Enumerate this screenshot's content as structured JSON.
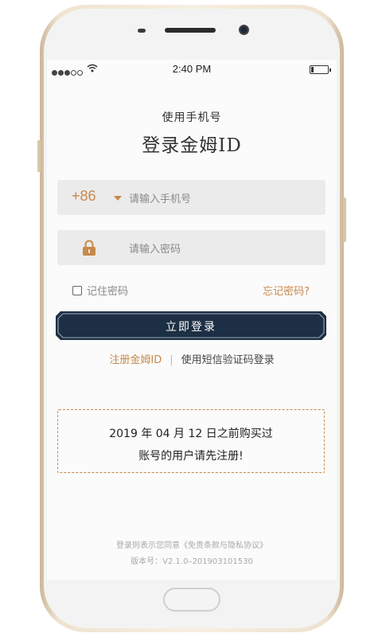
{
  "status_bar": {
    "time": "2:40 PM",
    "signal_icon": "signal-dots-icon",
    "wifi_icon": "wifi-icon",
    "battery_icon": "battery-icon"
  },
  "header": {
    "subtitle": "使用手机号",
    "title": "登录金姆ID"
  },
  "phone_input": {
    "country_code": "+86",
    "placeholder": "请输入手机号"
  },
  "password_input": {
    "placeholder": "请输入密码",
    "icon": "lock-icon"
  },
  "options": {
    "remember_label": "记住密码",
    "forgot_label": "忘记密码?"
  },
  "login_button": {
    "label": "立即登录"
  },
  "links": {
    "register": "注册金姆ID",
    "separator": "|",
    "sms_login": "使用短信验证码登录"
  },
  "notice": {
    "line1": "2019 年 04 月 12 日之前购买过",
    "line2": "账号的用户请先注册!"
  },
  "footer": {
    "agreement": "登录则表示您同意《免责条款与隐私协议》",
    "version": "版本号：V2.1.0–201903101530"
  },
  "colors": {
    "accent": "#c8894a",
    "button": "#1c2f44",
    "field_bg": "#ebebeb"
  }
}
